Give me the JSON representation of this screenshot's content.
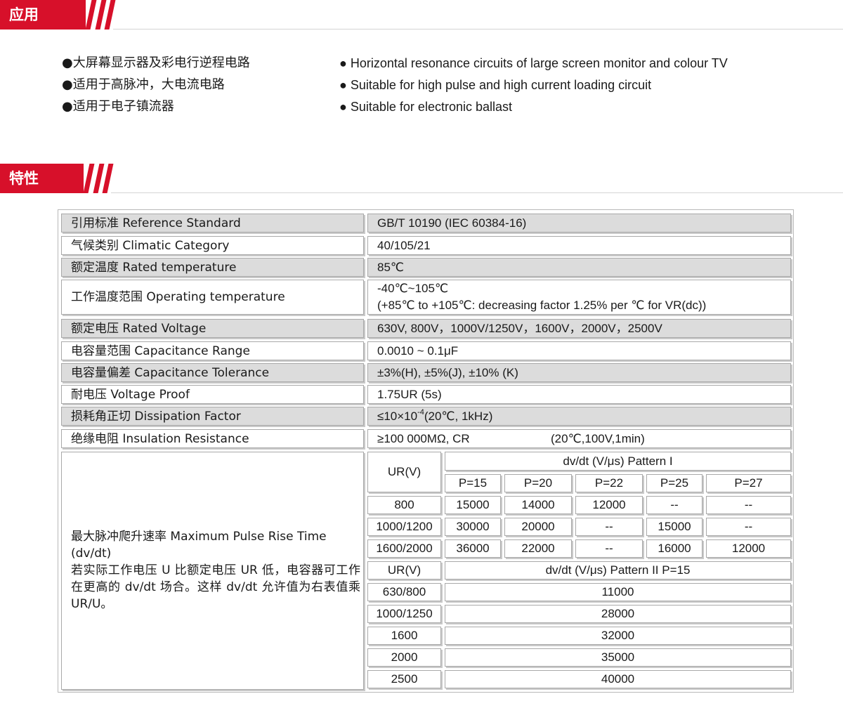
{
  "colors": {
    "accent": "#d7102a",
    "row_gray": "#dcdcdc",
    "border": "#a9a9a9"
  },
  "sections": {
    "application": {
      "title": "应用"
    },
    "characteristics": {
      "title": "特性"
    }
  },
  "application": {
    "cn": [
      "●大屏幕显示器及彩电行逆程电路",
      "●适用于高脉冲，大电流电路",
      "●适用于电子镇流器"
    ],
    "en": [
      "● Horizontal resonance circuits of large screen monitor and colour TV",
      "● Suitable for high pulse and high current loading circuit",
      "● Suitable for electronic ballast"
    ]
  },
  "specs": [
    {
      "label": "引用标准 Reference Standard",
      "value": "GB/T 10190 (IEC 60384-16)"
    },
    {
      "label": "气候类别 Climatic Category",
      "value": "40/105/21"
    },
    {
      "label": "额定温度 Rated temperature",
      "value": "85℃"
    },
    {
      "label": "工作温度范围 Operating temperature",
      "value_line1": "-40℃~105℃",
      "value_line2": "(+85℃ to +105℃: decreasing factor 1.25% per ℃ for VR(dc))"
    },
    {
      "label": "额定电压 Rated Voltage",
      "value": "630V, 800V，1000V/1250V，1600V，2000V，2500V"
    },
    {
      "label": "电容量范围 Capacitance Range",
      "value": "0.0010 ~ 0.1μF"
    },
    {
      "label": "电容量偏差 Capacitance Tolerance",
      "value": "±3%(H), ±5%(J), ±10% (K)"
    },
    {
      "label": "耐电压 Voltage Proof",
      "value": "1.75UR (5s)"
    },
    {
      "label": "损耗角正切 Dissipation Factor",
      "value_pre": "≤10×10",
      "value_sup": "-4",
      "value_post": "(20℃, 1kHz)"
    },
    {
      "label": "绝缘电阻 Insulation Resistance",
      "value_a": "≥100 000MΩ, CR",
      "value_b": "(20℃,100V,1min)"
    }
  ],
  "dvdt": {
    "desc_line1": "最大脉冲爬升速率  Maximum  Pulse  Rise  Time",
    "desc_line2": "(dv/dt)",
    "desc_line3": "若实际工作电压 U 比额定电压 UR 低，电容器可工作在更高的 dv/dt 场合。这样 dv/dt 允许值为右表值乘 UR/U。",
    "ur_header": "UR(V)",
    "pattern1_header": "dv/dt (V/μs)  Pattern I",
    "p_headers": [
      "P=15",
      "P=20",
      "P=22",
      "P=25",
      "P=27"
    ],
    "pattern1_rows": [
      {
        "ur": "800",
        "vals": [
          "15000",
          "14000",
          "12000",
          "--",
          "--"
        ]
      },
      {
        "ur": "1000/1200",
        "vals": [
          "30000",
          "20000",
          "--",
          "15000",
          "--"
        ]
      },
      {
        "ur": "1600/2000",
        "vals": [
          "36000",
          "22000",
          "--",
          "16000",
          "12000"
        ]
      }
    ],
    "pattern2_header": "dv/dt (V/μs)  Pattern II   P=15",
    "pattern2_rows": [
      {
        "ur": "630/800",
        "val": "11000"
      },
      {
        "ur": "1000/1250",
        "val": "28000"
      },
      {
        "ur": "1600",
        "val": "32000"
      },
      {
        "ur": "2000",
        "val": "35000"
      },
      {
        "ur": "2500",
        "val": "40000"
      }
    ]
  }
}
